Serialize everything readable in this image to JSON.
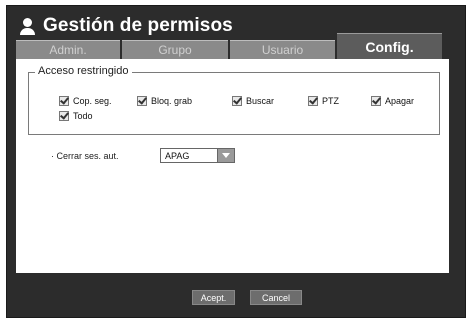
{
  "window": {
    "title": "Gestión de permisos",
    "title_icon": "user-icon"
  },
  "tabs": [
    {
      "label": "Admin.",
      "active": false
    },
    {
      "label": "Grupo",
      "active": false
    },
    {
      "label": "Usuario",
      "active": false
    },
    {
      "label": "Config.",
      "active": true
    }
  ],
  "restricted_access": {
    "legend": "Acceso restringido",
    "options": [
      {
        "label": "Cop. seg.",
        "checked": true
      },
      {
        "label": "Bloq. grab",
        "checked": true
      },
      {
        "label": "Buscar",
        "checked": true
      },
      {
        "label": "PTZ",
        "checked": true
      },
      {
        "label": "Apagar",
        "checked": true
      },
      {
        "label": "Todo",
        "checked": true
      }
    ]
  },
  "auto_logout": {
    "label": "· Cerrar ses. aut.",
    "value": "APAG"
  },
  "buttons": {
    "ok": "Acept.",
    "cancel": "Cancel"
  }
}
